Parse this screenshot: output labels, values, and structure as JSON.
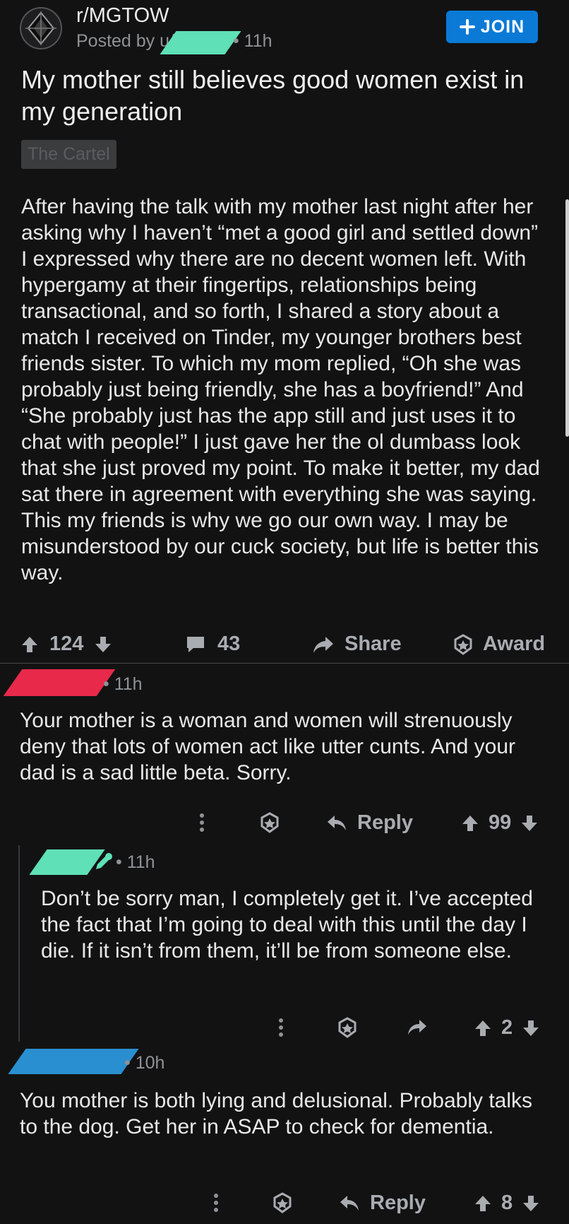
{
  "post": {
    "subreddit": "r/MGTOW",
    "posted_by_prefix": "Posted by u/",
    "time": "11h",
    "join_label": "JOIN",
    "title": "My mother still believes good women exist in my generation",
    "flair": "The Cartel",
    "body": "After having the talk with my mother last night after her asking why I haven’t “met a good girl and settled down” I expressed why there are no decent women left. With hypergamy at their fingertips, relationships being transactional, and so forth, I shared a story about a match I received on Tinder, my younger brothers best friends sister. To which my mom replied, “Oh she was probably just being friendly, she has a boyfriend!” And “She probably just has the app still and just uses it to chat with people!” I just gave her the ol dumbass look that she just proved my point. To make it better, my dad sat there in agreement with everything she was saying. This my friends is why we go our own way. I may be misunderstood by our cuck society, but life is better this way.",
    "votes": "124",
    "comments": "43",
    "share_label": "Share",
    "award_label": "Award"
  },
  "comments": [
    {
      "time": "11h",
      "body": "Your mother is a woman and women will strenuously deny that lots of women act like utter cunts. And your dad is a sad little beta. Sorry.",
      "reply_label": "Reply",
      "votes": "99",
      "redaction_color": "#e8294a"
    },
    {
      "time": "11h",
      "body": "Don’t be sorry man, I completely get it. I’ve accepted the fact that I’m going to deal with this until the day I die. If it isn’t from them, it’ll be from someone else.",
      "votes": "2",
      "redaction_color": "#5fe0b7"
    },
    {
      "time": "10h",
      "body": "You mother is both lying and delusional.  Probably talks to the dog.  Get her in ASAP to check for dementia.",
      "reply_label": "Reply",
      "votes": "8",
      "redaction_color": "#2a8fd0"
    }
  ],
  "colors": {
    "background": "#121213",
    "join_button": "#0a7ad6",
    "flair_bg": "#3b3c3e"
  },
  "icons": [
    "subreddit-avatar-icon",
    "plus-icon",
    "upvote-icon",
    "downvote-icon",
    "comment-icon",
    "share-icon",
    "award-icon",
    "more-icon",
    "reply-icon",
    "pencil-icon"
  ]
}
